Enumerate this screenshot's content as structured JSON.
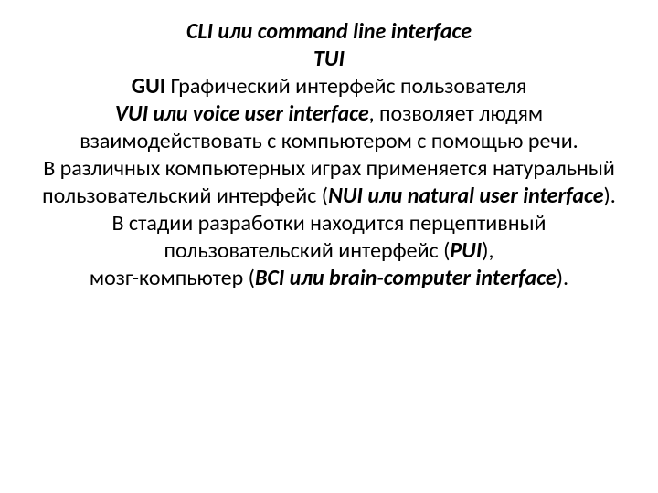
{
  "slide": {
    "line1": "CLI или command line interface",
    "line2": "TUI",
    "line3_bold": "GUI",
    "line3_rest": " Графический интерфейс пользователя",
    "line4_em": "VUI или voice user interface",
    "line4_rest": ", позволяет людям взаимодействовать с компьютером с помощью речи.",
    "line5_pre": "В различных компьютерных играх применяется натуральный пользовательский интерфейс (",
    "line5_em": "NUI или natural user interface",
    "line5_post": ").",
    "line6_pre": "В стадии разработки находится перцептивный пользовательский интерфейс (",
    "line6_em": "PUI",
    "line6_post": "),",
    "line7_pre": "мозг-компьютер (",
    "line7_em": "BCI или brain-computer interface",
    "line7_post": ")."
  }
}
